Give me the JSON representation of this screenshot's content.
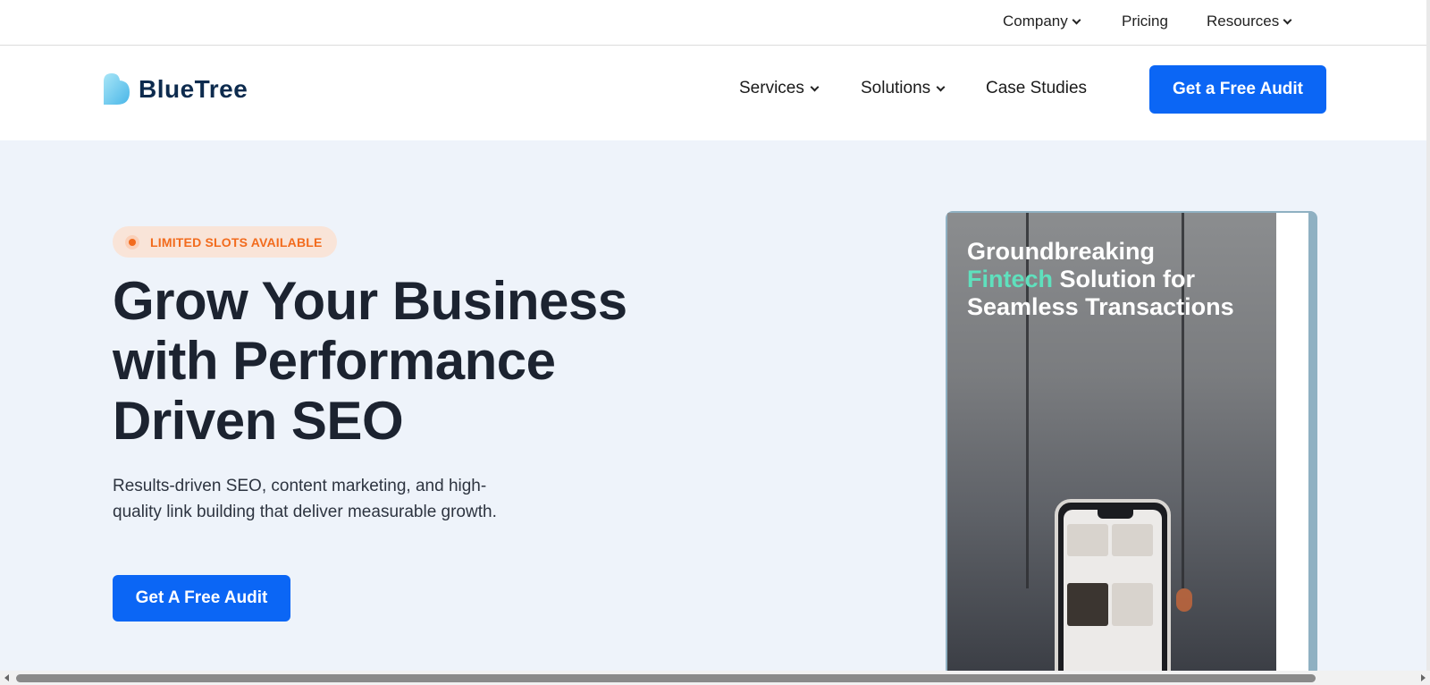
{
  "topbar": {
    "items": [
      {
        "label": "Company",
        "has_dropdown": true
      },
      {
        "label": "Pricing",
        "has_dropdown": false
      },
      {
        "label": "Resources",
        "has_dropdown": true
      }
    ]
  },
  "header": {
    "logo_text": "BlueTree",
    "nav": [
      {
        "label": "Services",
        "has_dropdown": true
      },
      {
        "label": "Solutions",
        "has_dropdown": true
      },
      {
        "label": "Case Studies",
        "has_dropdown": false
      }
    ],
    "cta_label": "Get a Free Audit"
  },
  "hero": {
    "badge": "LIMITED SLOTS AVAILABLE",
    "headline_lines": [
      "Grow Your Business",
      "with Performance",
      "Driven SEO"
    ],
    "subtext_lines": [
      "Results-driven SEO, content marketing, and high-",
      "quality link building that deliver measurable growth."
    ],
    "cta_label": "Get A Free Audit"
  },
  "card": {
    "title_line1": "Groundbreaking",
    "title_accent": "Fintech",
    "title_line2_rest": " Solution for",
    "title_line3": "Seamless Transactions"
  },
  "colors": {
    "brand_blue": "#0b66f5",
    "badge_orange": "#f26b1d",
    "card_accent": "#5fe0bd",
    "hero_bg": "#eef3fa"
  }
}
